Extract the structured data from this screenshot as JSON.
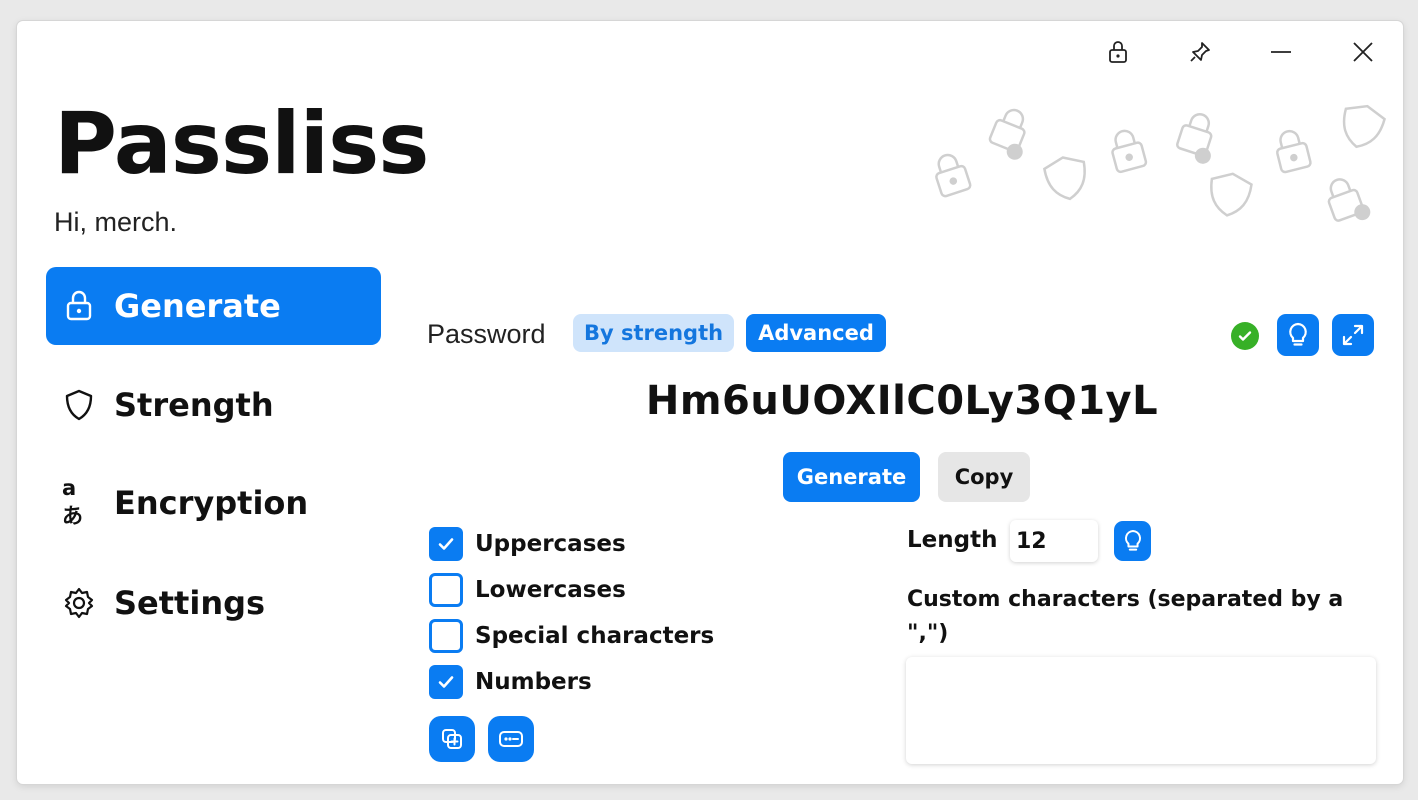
{
  "app": {
    "title": "Passliss",
    "greeting": "Hi, merch."
  },
  "titlebar": {
    "icons": [
      "lock-icon",
      "pin-icon",
      "minimize-icon",
      "close-icon"
    ]
  },
  "nav": {
    "items": [
      {
        "label": "Generate",
        "icon": "lock-icon",
        "active": true
      },
      {
        "label": "Strength",
        "icon": "shield-icon",
        "active": false
      },
      {
        "label": "Encryption",
        "icon": "translate-icon",
        "active": false
      },
      {
        "label": "Settings",
        "icon": "gear-icon",
        "active": false
      }
    ]
  },
  "generator": {
    "label": "Password",
    "modes": {
      "by_strength": "By strength",
      "advanced": "Advanced"
    },
    "selected_mode": "Advanced",
    "password": "Hm6uUOXIlC0Ly3Q1yL",
    "generate_label": "Generate",
    "copy_label": "Copy",
    "options": [
      {
        "label": "Uppercases",
        "checked": true
      },
      {
        "label": "Lowercases",
        "checked": false
      },
      {
        "label": "Special characters",
        "checked": false
      },
      {
        "label": "Numbers",
        "checked": true
      }
    ],
    "length_label": "Length",
    "length_value": "12",
    "custom_label": "Custom characters (separated by a \",\")",
    "custom_value": ""
  },
  "colors": {
    "accent": "#0a7cf2",
    "accent_light": "#cfe4fb",
    "success": "#37b027"
  }
}
